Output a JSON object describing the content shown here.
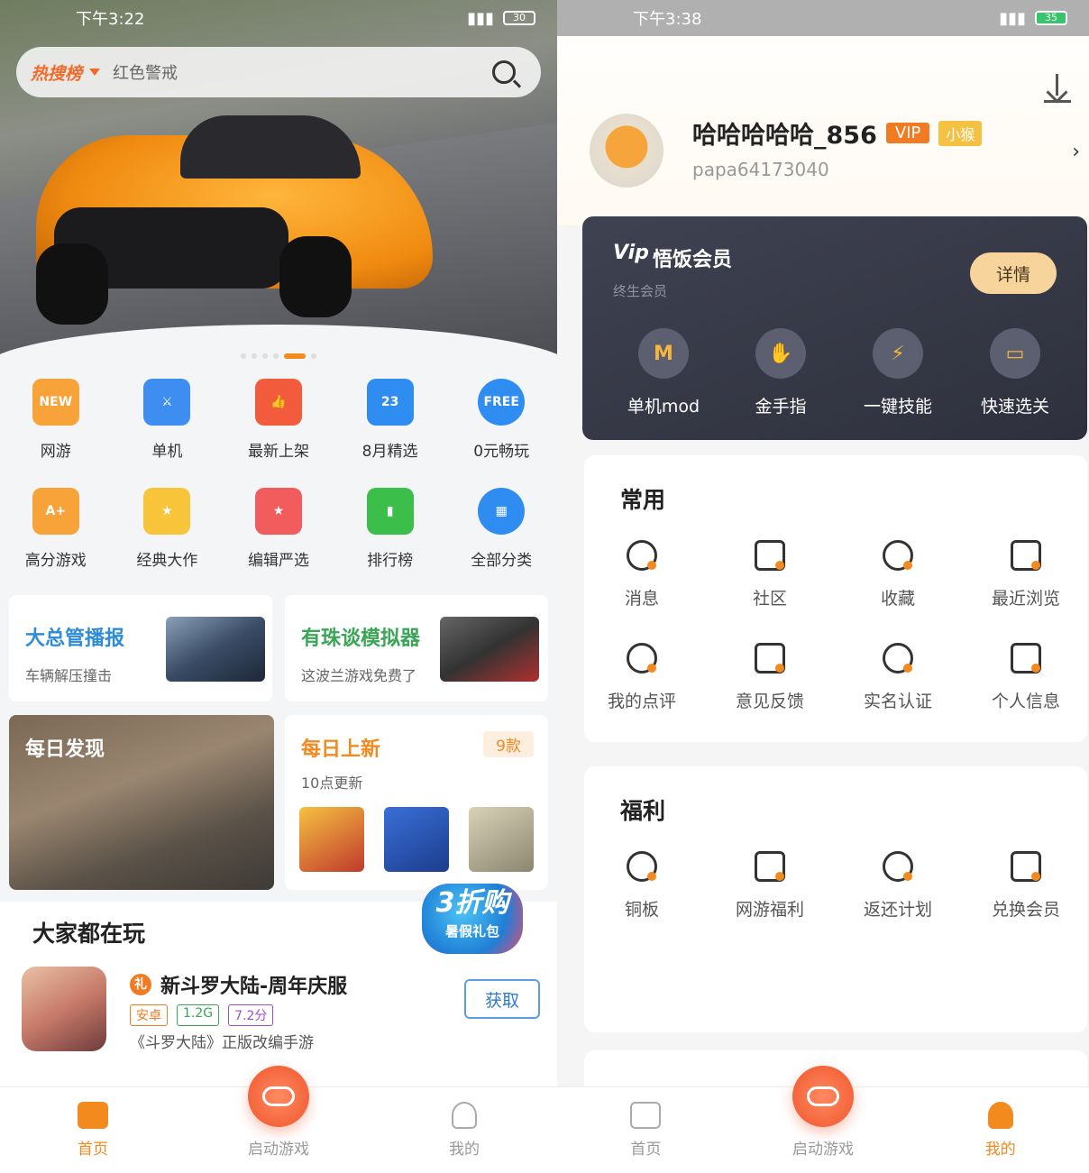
{
  "left": {
    "status": {
      "time": "下午3:22",
      "battery": "30"
    },
    "search": {
      "hot_label": "热搜榜",
      "query": "红色警戒"
    },
    "categories": [
      {
        "label": "网游",
        "icon": "new-badge-icon",
        "glyph": "NEW",
        "color": "#f8a23a"
      },
      {
        "label": "单机",
        "icon": "sword-icon",
        "glyph": "⚔",
        "color": "#3d8ef0"
      },
      {
        "label": "最新上架",
        "icon": "thumbs-up-icon",
        "glyph": "👍",
        "color": "#f25c3c"
      },
      {
        "label": "8月精选",
        "icon": "calendar-icon",
        "glyph": "23",
        "color": "#2f8cf0"
      },
      {
        "label": "0元畅玩",
        "icon": "free-icon",
        "glyph": "FREE",
        "color": "#2f8cf0"
      },
      {
        "label": "高分游戏",
        "icon": "shield-score-icon",
        "glyph": "A+",
        "color": "#f8a23a"
      },
      {
        "label": "经典大作",
        "icon": "medal-icon",
        "glyph": "★",
        "color": "#f8c43a"
      },
      {
        "label": "编辑严选",
        "icon": "editor-box-icon",
        "glyph": "★",
        "color": "#f25c5c"
      },
      {
        "label": "排行榜",
        "icon": "bar-chart-icon",
        "glyph": "▮",
        "color": "#3bbf4a"
      },
      {
        "label": "全部分类",
        "icon": "grid-icon",
        "glyph": "▦",
        "color": "#2f8cf0"
      }
    ],
    "promo_cards": [
      {
        "title": "大总管播报",
        "subtitle": "车辆解压撞击",
        "color": "#2f8cd6"
      },
      {
        "title": "有珠谈模拟器",
        "subtitle": "这波兰游戏免费了",
        "color": "#3aa656"
      }
    ],
    "daily_discover": {
      "title": "每日发现"
    },
    "daily_new": {
      "title": "每日上新",
      "count": "9款",
      "subtitle": "10点更新"
    },
    "everyone_playing": {
      "header": "大家都在玩",
      "promo_line1": "3折购",
      "promo_line2": "暑假礼包",
      "game": {
        "title": "新斗罗大陆-周年庆服",
        "gift_glyph": "礼",
        "tags": [
          {
            "text": "安卓",
            "color": "#f07b22"
          },
          {
            "text": "1.2G",
            "color": "#3aa656"
          },
          {
            "text": "7.2分",
            "color": "#a24ccf"
          }
        ],
        "desc": "《斗罗大陆》正版改编手游",
        "button": "获取"
      }
    },
    "tabbar": {
      "home": "首页",
      "launch": "启动游戏",
      "mine": "我的"
    }
  },
  "right": {
    "status": {
      "time": "下午3:38",
      "battery": "35"
    },
    "profile": {
      "username": "哈哈哈哈哈_856",
      "vip": "VIP",
      "level": "小猴",
      "id": "papa64173040",
      "chevron": "›"
    },
    "vip_card": {
      "logo": "Vip",
      "title": "悟饭会员",
      "subtitle": "终生会员",
      "detail_button": "详情",
      "features": [
        {
          "label": "单机mod",
          "glyph": "M",
          "icon": "mod-icon"
        },
        {
          "label": "金手指",
          "glyph": "✋",
          "icon": "golden-finger-icon"
        },
        {
          "label": "一键技能",
          "glyph": "⚡",
          "icon": "lightning-icon"
        },
        {
          "label": "快速选关",
          "glyph": "▭",
          "icon": "level-select-icon"
        }
      ]
    },
    "common": {
      "header": "常用",
      "items": [
        {
          "label": "消息",
          "icon": "message-icon"
        },
        {
          "label": "社区",
          "icon": "home-community-icon"
        },
        {
          "label": "收藏",
          "icon": "star-icon"
        },
        {
          "label": "最近浏览",
          "icon": "clock-icon"
        },
        {
          "label": "我的点评",
          "icon": "review-star-icon"
        },
        {
          "label": "意见反馈",
          "icon": "feedback-icon"
        },
        {
          "label": "实名认证",
          "icon": "id-card-icon"
        },
        {
          "label": "个人信息",
          "icon": "user-info-icon"
        }
      ]
    },
    "welfare": {
      "header": "福利",
      "items": [
        {
          "label": "铜板",
          "icon": "coin-icon"
        },
        {
          "label": "网游福利",
          "icon": "crown-gift-icon"
        },
        {
          "label": "返还计划",
          "icon": "return-plan-icon"
        },
        {
          "label": "兑换会员",
          "icon": "vip-bag-icon"
        }
      ]
    },
    "tabbar": {
      "home": "首页",
      "launch": "启动游戏",
      "mine": "我的"
    }
  }
}
